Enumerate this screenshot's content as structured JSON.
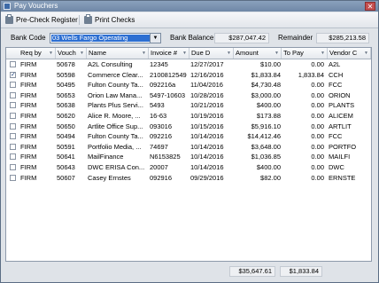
{
  "window": {
    "title": "Pay Vouchers",
    "close_label": "✕"
  },
  "toolbar": {
    "precheck_label": "Pre-Check Register",
    "print_label": "Print Checks"
  },
  "bank": {
    "code_label": "Bank Code",
    "selected": "03        Wells Fargo Operating",
    "balance_label": "Bank Balance",
    "balance": "$287,047.42",
    "remainder_label": "Remainder",
    "remainder": "$285,213.58"
  },
  "columns": [
    "Req by",
    "Vouch",
    "Name",
    "Invoice #",
    "Due D",
    "Amount",
    "To Pay",
    "Vendor C"
  ],
  "rows": [
    {
      "checked": false,
      "req": "FIRM",
      "vouch": "50678",
      "name": "A2L Consulting",
      "invoice": "12345",
      "due": "12/27/2017",
      "amount": "$10.00",
      "topay": "0.00",
      "vendor": "A2L"
    },
    {
      "checked": true,
      "req": "FIRM",
      "vouch": "50598",
      "name": "Commerce Clear...",
      "invoice": "2100812549",
      "due": "12/16/2016",
      "amount": "$1,833.84",
      "topay": "1,833.84",
      "vendor": "CCH"
    },
    {
      "checked": false,
      "req": "FIRM",
      "vouch": "50495",
      "name": "Fulton County Ta...",
      "invoice": "092216a",
      "due": "11/04/2016",
      "amount": "$4,730.48",
      "topay": "0.00",
      "vendor": "FCC"
    },
    {
      "checked": false,
      "req": "FIRM",
      "vouch": "50653",
      "name": "Orion Law Mana...",
      "invoice": "5497-10603",
      "due": "10/28/2016",
      "amount": "$3,000.00",
      "topay": "0.00",
      "vendor": "ORION"
    },
    {
      "checked": false,
      "req": "FIRM",
      "vouch": "50638",
      "name": "Plants Plus Servi...",
      "invoice": "5493",
      "due": "10/21/2016",
      "amount": "$400.00",
      "topay": "0.00",
      "vendor": "PLANTS"
    },
    {
      "checked": false,
      "req": "FIRM",
      "vouch": "50620",
      "name": "Alice R. Moore, ...",
      "invoice": "16-63",
      "due": "10/19/2016",
      "amount": "$173.88",
      "topay": "0.00",
      "vendor": "ALICEM"
    },
    {
      "checked": false,
      "req": "FIRM",
      "vouch": "50650",
      "name": "Artlite Office Sup...",
      "invoice": "093016",
      "due": "10/15/2016",
      "amount": "$5,916.10",
      "topay": "0.00",
      "vendor": "ARTLIT"
    },
    {
      "checked": false,
      "req": "FIRM",
      "vouch": "50494",
      "name": "Fulton County Ta...",
      "invoice": "092216",
      "due": "10/14/2016",
      "amount": "$14,412.46",
      "topay": "0.00",
      "vendor": "FCC"
    },
    {
      "checked": false,
      "req": "FIRM",
      "vouch": "50591",
      "name": "Portfolio Media, ...",
      "invoice": "74697",
      "due": "10/14/2016",
      "amount": "$3,648.00",
      "topay": "0.00",
      "vendor": "PORTFO"
    },
    {
      "checked": false,
      "req": "FIRM",
      "vouch": "50641",
      "name": "MailFinance",
      "invoice": "N6153825",
      "due": "10/14/2016",
      "amount": "$1,036.85",
      "topay": "0.00",
      "vendor": "MAILFI"
    },
    {
      "checked": false,
      "req": "FIRM",
      "vouch": "50643",
      "name": "DWC ERISA Con...",
      "invoice": "20007",
      "due": "10/14/2016",
      "amount": "$400.00",
      "topay": "0.00",
      "vendor": "DWC"
    },
    {
      "checked": false,
      "req": "FIRM",
      "vouch": "50607",
      "name": "Casey Ernstes",
      "invoice": "092916",
      "due": "09/29/2016",
      "amount": "$82.00",
      "topay": "0.00",
      "vendor": "ERNSTE"
    }
  ],
  "totals": {
    "amount": "$35,647.61",
    "topay": "$1,833.84"
  },
  "colors": {
    "title_bg": "#7b92b1",
    "selection": "#2d6fd2"
  }
}
